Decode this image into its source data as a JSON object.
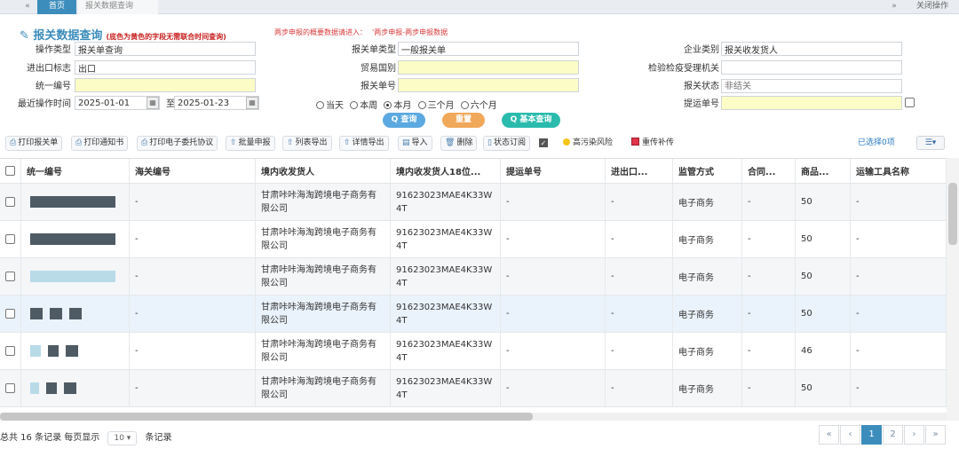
{
  "tabs": {
    "nav_left": "«",
    "nav_right": "»",
    "items": [
      "首页",
      "报关数据查询"
    ],
    "right_label": "关闭操作"
  },
  "form": {
    "title": "报关数据查询",
    "title_hint": "(底色为黄色的字段无需联合时间查询)",
    "notice_label": "两步申报的概要数据请进入：",
    "notice_link": "'两步申报-两步申报数据",
    "fields": {
      "op_type": {
        "label": "操作类型",
        "value": "报关单查询"
      },
      "decl_type": {
        "label": "报关单类型",
        "value": "一般报关单"
      },
      "company_type": {
        "label": "企业类别",
        "value": "报关收发货人"
      },
      "ie_flag": {
        "label": "进出口标志",
        "value": "出口"
      },
      "trade_country": {
        "label": "贸易国别",
        "value": ""
      },
      "inspection_org": {
        "label": "检验检疫受理机关",
        "value": ""
      },
      "unified_no": {
        "label": "统一编号",
        "value": ""
      },
      "decl_no": {
        "label": "报关单号",
        "value": ""
      },
      "decl_status": {
        "label": "报关状态",
        "value": "",
        "placeholder": "非结关"
      },
      "recent_time": {
        "label": "最近操作时间",
        "from": "2025-01-01",
        "to_label": "至",
        "to": "2025-01-23"
      },
      "bill_no": {
        "label": "提运单号",
        "value": ""
      }
    },
    "radios": [
      {
        "label": "当天",
        "checked": false
      },
      {
        "label": "本周",
        "checked": false
      },
      {
        "label": "本月",
        "checked": true
      },
      {
        "label": "三个月",
        "checked": false
      },
      {
        "label": "六个月",
        "checked": false
      }
    ],
    "buttons": {
      "search": "Q 查询",
      "reset": "重置",
      "basic": "Q 基本查询"
    }
  },
  "toolbar": {
    "items": [
      "打印报关单",
      "打印通知书",
      "打印电子委托协议",
      "批量申报",
      "列表导出",
      "详情导出",
      "导入",
      "删除",
      "状态订阅",
      "高污染风险",
      "重传补传"
    ],
    "selected": "已选择0项",
    "column_toggle": "☰▾"
  },
  "table": {
    "headers": [
      "统一编号",
      "海关编号",
      "境内收发货人",
      "境内收发货人18位...",
      "提运单号",
      "进出口...",
      "监管方式",
      "合同...",
      "商品...",
      "运输工具名称"
    ],
    "rows": [
      {
        "hai": "-",
        "company": "甘肃咔咔海淘跨境电子商务有限公司",
        "code": "91623023MAE4K33W4T",
        "bill": "-",
        "ie": "-",
        "mode": "电子商务",
        "contract": "-",
        "goods": "50",
        "transport": "-"
      },
      {
        "hai": "-",
        "company": "甘肃咔咔海淘跨境电子商务有限公司",
        "code": "91623023MAE4K33W4T",
        "bill": "-",
        "ie": "-",
        "mode": "电子商务",
        "contract": "-",
        "goods": "50",
        "transport": "-"
      },
      {
        "hai": "-",
        "company": "甘肃咔咔海淘跨境电子商务有限公司",
        "code": "91623023MAE4K33W4T",
        "bill": "-",
        "ie": "-",
        "mode": "电子商务",
        "contract": "-",
        "goods": "50",
        "transport": "-"
      },
      {
        "hai": "-",
        "company": "甘肃咔咔海淘跨境电子商务有限公司",
        "code": "91623023MAE4K33W4T",
        "bill": "-",
        "ie": "-",
        "mode": "电子商务",
        "contract": "-",
        "goods": "50",
        "transport": "-"
      },
      {
        "hai": "-",
        "company": "甘肃咔咔海淘跨境电子商务有限公司",
        "code": "91623023MAE4K33W4T",
        "bill": "-",
        "ie": "-",
        "mode": "电子商务",
        "contract": "-",
        "goods": "46",
        "transport": "-"
      },
      {
        "hai": "-",
        "company": "甘肃咔咔海淘跨境电子商务有限公司",
        "code": "91623023MAE4K33W4T",
        "bill": "-",
        "ie": "-",
        "mode": "电子商务",
        "contract": "-",
        "goods": "50",
        "transport": "-"
      }
    ]
  },
  "pager": {
    "total": "总共 16 条记录",
    "per_page_label": "每页显示",
    "per_page": "10 ▾",
    "records": "条记录",
    "first": "«",
    "prev": "‹",
    "pages": [
      "1",
      "2"
    ],
    "next": "›",
    "last": "»"
  },
  "colors": {
    "accent": "#3c8dbc",
    "highlight_field": "#fbfcc6"
  }
}
